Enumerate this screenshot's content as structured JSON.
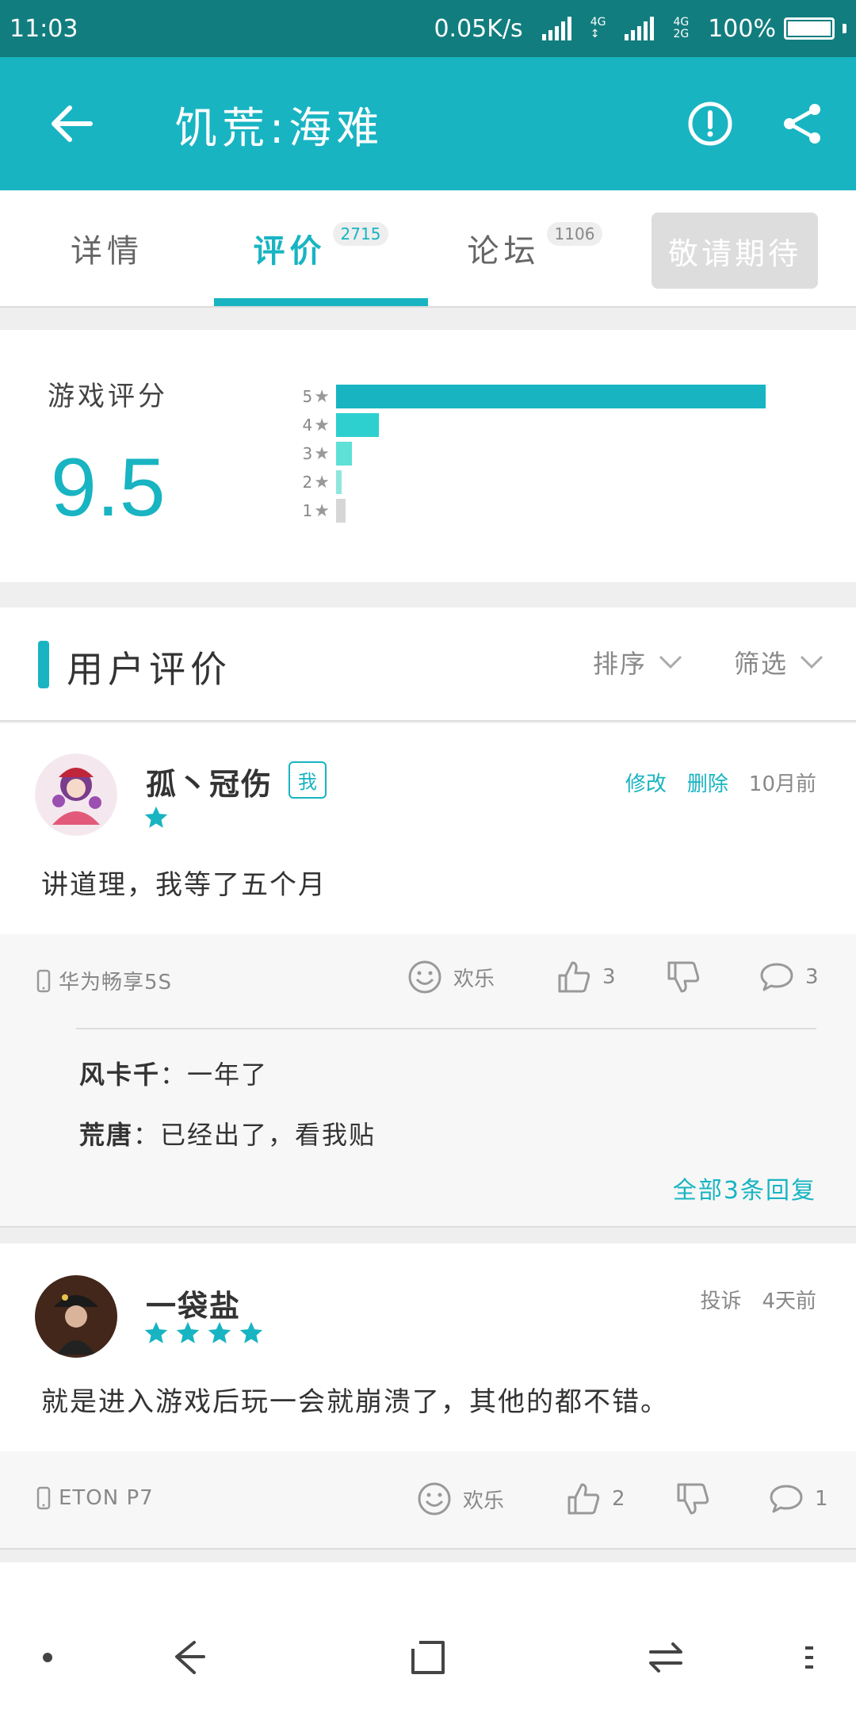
{
  "status_bar": {
    "time": "11:03",
    "net_speed": "0.05K/s",
    "net_4g_top": "4G",
    "net_4g": "4G",
    "net_2g": "2G",
    "battery": "100%"
  },
  "app_bar": {
    "title": "饥荒:海难",
    "back_icon": "back-arrow-icon",
    "report_icon": "alert-circle-icon",
    "share_icon": "share-icon"
  },
  "tabs": [
    {
      "label": "详情",
      "badge": ""
    },
    {
      "label": "评价",
      "badge": "2715",
      "active": true
    },
    {
      "label": "论坛",
      "badge": "1106"
    }
  ],
  "coming_button": "敬请期待",
  "score": {
    "label": "游戏评分",
    "value": "9.5",
    "distribution": [
      {
        "stars": "5",
        "fraction": 0.91
      },
      {
        "stars": "4",
        "fraction": 0.09
      },
      {
        "stars": "3",
        "fraction": 0.033
      },
      {
        "stars": "2",
        "fraction": 0.01
      },
      {
        "stars": "1",
        "fraction": 0.02
      }
    ],
    "colors": [
      "#18b4c2",
      "#2ecfcf",
      "#5ee0d6",
      "#8fe6df",
      "#d6d6d6"
    ]
  },
  "reviews_section": {
    "title": "用户评价",
    "sort_label": "排序",
    "filter_label": "筛选"
  },
  "reviews": [
    {
      "user": "孤丶冠伤",
      "me_tag": "我",
      "rating": 1,
      "edit": "修改",
      "delete": "删除",
      "time": "10月前",
      "text": "讲道理，我等了五个月",
      "device": "华为畅享5S",
      "mood": "欢乐",
      "likes": "3",
      "comments": "3",
      "replies": [
        {
          "user": "风卡千",
          "text": "一年了"
        },
        {
          "user": "荒唐",
          "text": "已经出了，看我贴"
        }
      ],
      "all_replies": "全部3条回复"
    },
    {
      "user": "一袋盐",
      "rating": 4,
      "report": "投诉",
      "time": "4天前",
      "text": "就是进入游戏后玩一会就崩溃了，其他的都不错。",
      "device": "ETON P7",
      "mood": "欢乐",
      "likes": "2",
      "comments": "1"
    }
  ],
  "accent_color": "#18b4c2"
}
